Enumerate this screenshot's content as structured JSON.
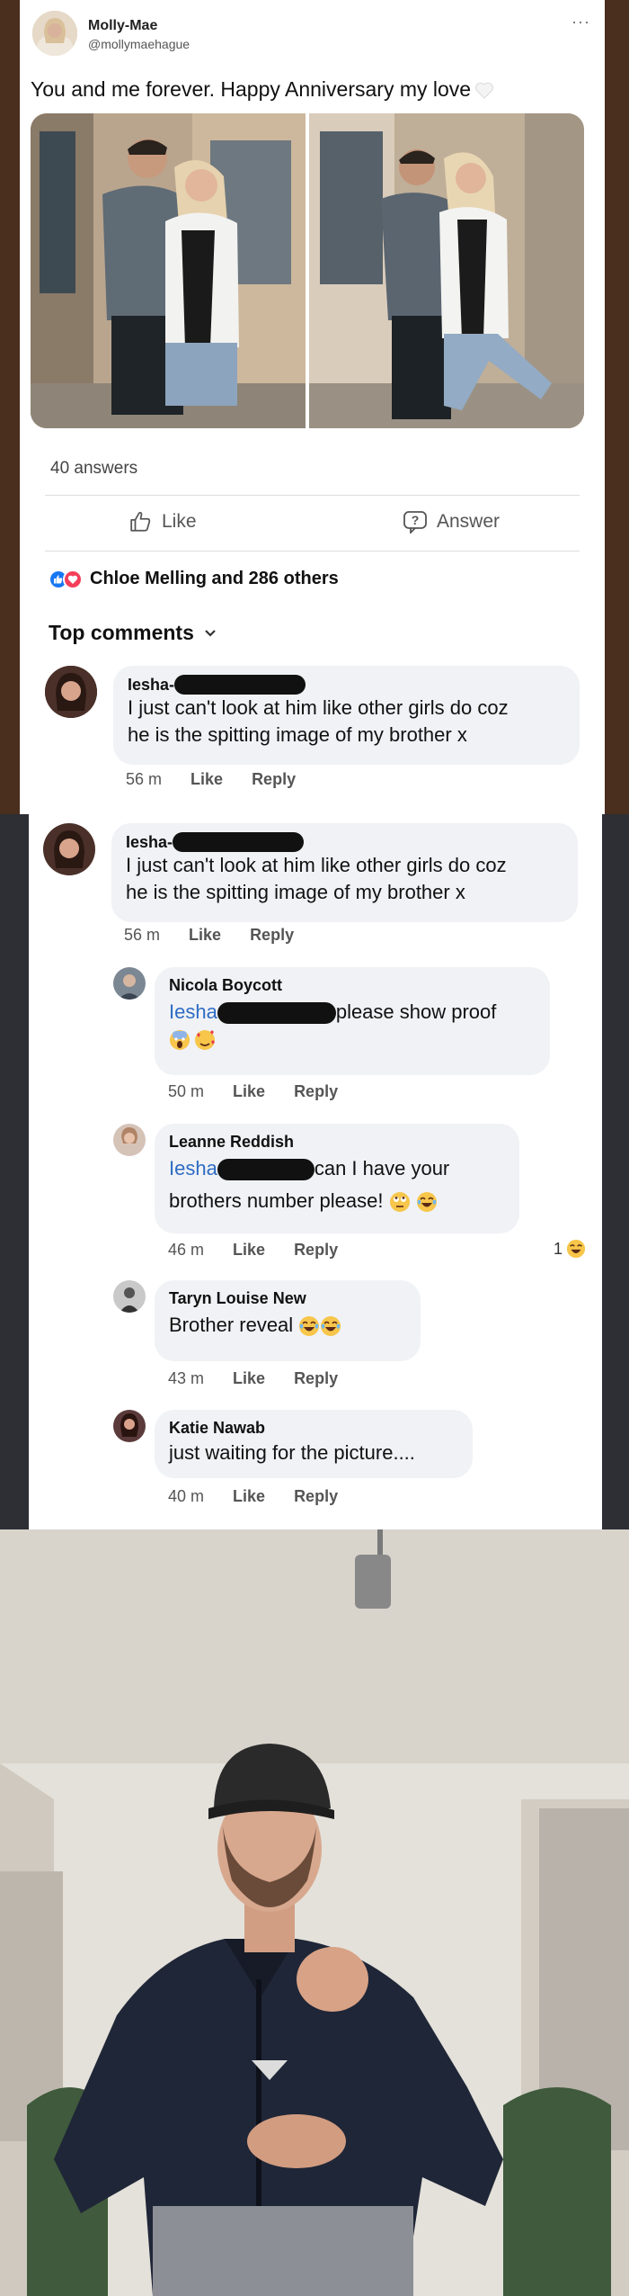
{
  "post": {
    "author_name": "Molly-Mae",
    "author_handle": "@mollymaehague",
    "more_icon": "···",
    "text": "You and me forever. Happy Anniversary my love",
    "answers_count": "40 answers",
    "like_label": "Like",
    "answer_label": "Answer",
    "reactions_text": "Chloe Melling and 286 others",
    "top_comments_label": "Top comments"
  },
  "comments_top": [
    {
      "name": "Iesha-",
      "text_line1": "I just can't look at him like other girls do coz",
      "text_line2": "he is the spitting image of my brother x",
      "time": "56 m",
      "like": "Like",
      "reply": "Reply"
    }
  ],
  "thread": {
    "main": {
      "name": "Iesha-",
      "text_line1": "I just can't look at him like other girls do coz",
      "text_line2": "he is the spitting image of my brother x",
      "time": "56 m",
      "like": "Like",
      "reply": "Reply"
    },
    "replies": [
      {
        "name": "Nicola Boycott",
        "mention": "Iesha",
        "text": "please show proof",
        "time": "50 m",
        "like": "Like",
        "reply": "Reply"
      },
      {
        "name": "Leanne Reddish",
        "mention": "Iesha",
        "text": "can I have your",
        "text_line2": "brothers number please!",
        "time": "46 m",
        "like": "Like",
        "reply": "Reply",
        "badge_count": "1"
      },
      {
        "name": "Taryn Louise New",
        "text": "Brother reveal",
        "time": "43 m",
        "like": "Like",
        "reply": "Reply"
      },
      {
        "name": "Katie Nawab",
        "text": "just waiting for the picture....",
        "time": "40 m",
        "like": "Like",
        "reply": "Reply"
      }
    ]
  },
  "colors": {
    "mention": "#2e6cc4",
    "bubble": "#f0f2f5",
    "like_blue": "#1877f2",
    "love_red": "#f33e58"
  }
}
